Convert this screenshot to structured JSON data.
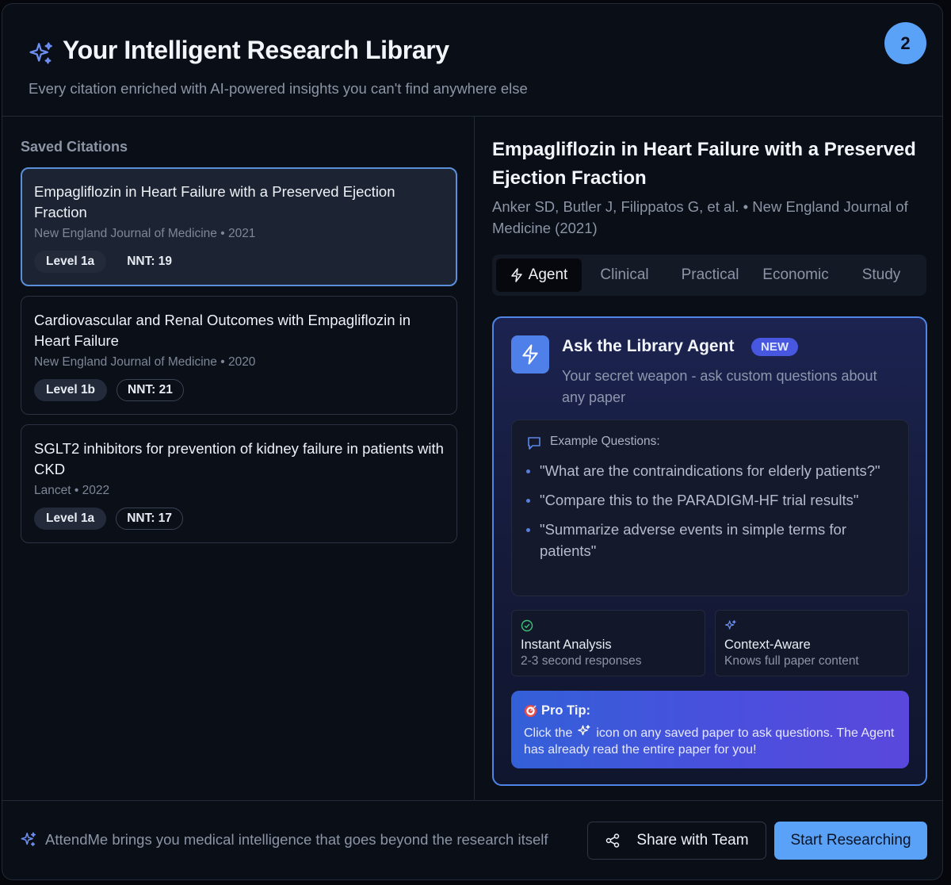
{
  "header": {
    "title": "Your Intelligent Research Library",
    "subtitle": "Every citation enriched with AI-powered insights you can't find anywhere else",
    "step_badge": "2"
  },
  "sidebar": {
    "label": "Saved Citations",
    "citations": [
      {
        "title": "Empagliflozin in Heart Failure with a Preserved Ejection Fraction",
        "journal": "New England Journal of Medicine",
        "year": "2021",
        "meta": "New England Journal of Medicine • 2021",
        "level": "Level 1a",
        "nnt": "NNT: 19",
        "active": true
      },
      {
        "title": "Cardiovascular and Renal Outcomes with Empagliflozin in Heart Failure",
        "journal": "New England Journal of Medicine",
        "year": "2020",
        "meta": "New England Journal of Medicine • 2020",
        "level": "Level 1b",
        "nnt": "NNT: 21",
        "active": false
      },
      {
        "title": "SGLT2 inhibitors for prevention of kidney failure in patients with CKD",
        "journal": "Lancet",
        "year": "2022",
        "meta": "Lancet • 2022",
        "level": "Level 1a",
        "nnt": "NNT: 17",
        "active": false
      }
    ]
  },
  "detail": {
    "title": "Empagliflozin in Heart Failure with a Preserved Ejection Fraction",
    "authors": "Anker SD, Butler J, Filippatos G, et al. • New England Journal of Medicine (2021)",
    "tabs": [
      {
        "label": "Agent",
        "icon": "bolt-icon",
        "active": true
      },
      {
        "label": "Clinical",
        "active": false
      },
      {
        "label": "Practical",
        "active": false
      },
      {
        "label": "Economic",
        "active": false
      },
      {
        "label": "Study",
        "active": false
      }
    ],
    "agent": {
      "heading": "Ask the Library Agent",
      "badge": "NEW",
      "description": "Your secret weapon - ask custom questions about any paper",
      "examples_label": "Example Questions:",
      "examples": [
        "\"What are the contraindications for elderly patients?\"",
        "\"Compare this to the PARADIGM-HF trial results\"",
        "\"Summarize adverse events in simple terms for patients\""
      ],
      "features": [
        {
          "title": "Instant Analysis",
          "desc": "2-3 second responses",
          "icon": "check-circle-icon"
        },
        {
          "title": "Context-Aware",
          "desc": "Knows full paper content",
          "icon": "sparkle-icon"
        }
      ],
      "pro_tip": {
        "title": "Pro Tip:",
        "text_before": "Click the",
        "text_after": "icon on any saved paper to ask questions. The Agent has already read the entire paper for you!"
      }
    }
  },
  "footer": {
    "text": "AttendMe brings you medical intelligence that goes beyond the research itself",
    "share_label": "Share with Team",
    "start_label": "Start Researching"
  },
  "colors": {
    "accent": "#5aa2f7",
    "agent_border": "#4f86e6",
    "badge": "#4757e0",
    "background": "#0a0e17"
  }
}
